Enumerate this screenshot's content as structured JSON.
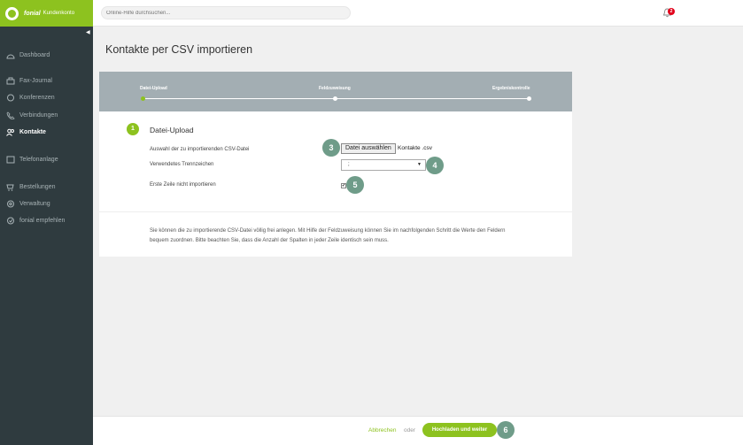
{
  "brand": {
    "name": "fonial",
    "subtitle": "Kundenkonto"
  },
  "search": {
    "placeholder": "Online-Hilfe durchsuchen..."
  },
  "notifications": {
    "count": "2"
  },
  "sidebar": {
    "items": [
      {
        "label": "Dashboard",
        "icon": "dashboard-icon"
      },
      {
        "label": "Fax-Journal",
        "icon": "fax-icon"
      },
      {
        "label": "Konferenzen",
        "icon": "conference-icon"
      },
      {
        "label": "Verbindungen",
        "icon": "phone-icon"
      },
      {
        "label": "Kontakte",
        "icon": "contacts-icon",
        "active": true
      },
      {
        "label": "Telefonanlage",
        "icon": "pbx-icon"
      },
      {
        "label": "Bestellungen",
        "icon": "cart-icon"
      },
      {
        "label": "Verwaltung",
        "icon": "settings-icon"
      },
      {
        "label": "fonial empfehlen",
        "icon": "recommend-icon"
      }
    ]
  },
  "page": {
    "title": "Kontakte per CSV importieren"
  },
  "steps": [
    {
      "label": "Datei-Upload",
      "active": true
    },
    {
      "label": "Feldzuweisung"
    },
    {
      "label": "Ergebniskontrolle"
    }
  ],
  "section": {
    "number": "1",
    "title": "Datei-Upload",
    "file_label": "Auswahl der zu importierenden CSV-Datei",
    "file_button": "Datei auswählen",
    "file_name": "Kontakte .csv",
    "separator_label": "Verwendetes Trennzeichen",
    "separator_value": ";",
    "skip_first_label": "Erste Zeile nicht importieren",
    "skip_first_checked": true
  },
  "info_text": "Sie können die zu importierende CSV-Datei völlig frei anlegen. Mit Hilfe der Feldzuweisung können Sie im nachfolgenden Schritt die Werte den Feldern bequem zuordnen. Bitte beachten Sie, dass die Anzahl der Spalten in jeder Zeile identisch sein muss.",
  "callouts": [
    "3",
    "4",
    "5",
    "6"
  ],
  "footer": {
    "cancel": "Abbrechen",
    "or": "oder",
    "submit": "Hochladen und weiter"
  },
  "colors": {
    "accent": "#8dc21f",
    "sidebar": "#2f3b3f",
    "callout": "#6f9c89",
    "stepbar": "#a3aeb3"
  }
}
